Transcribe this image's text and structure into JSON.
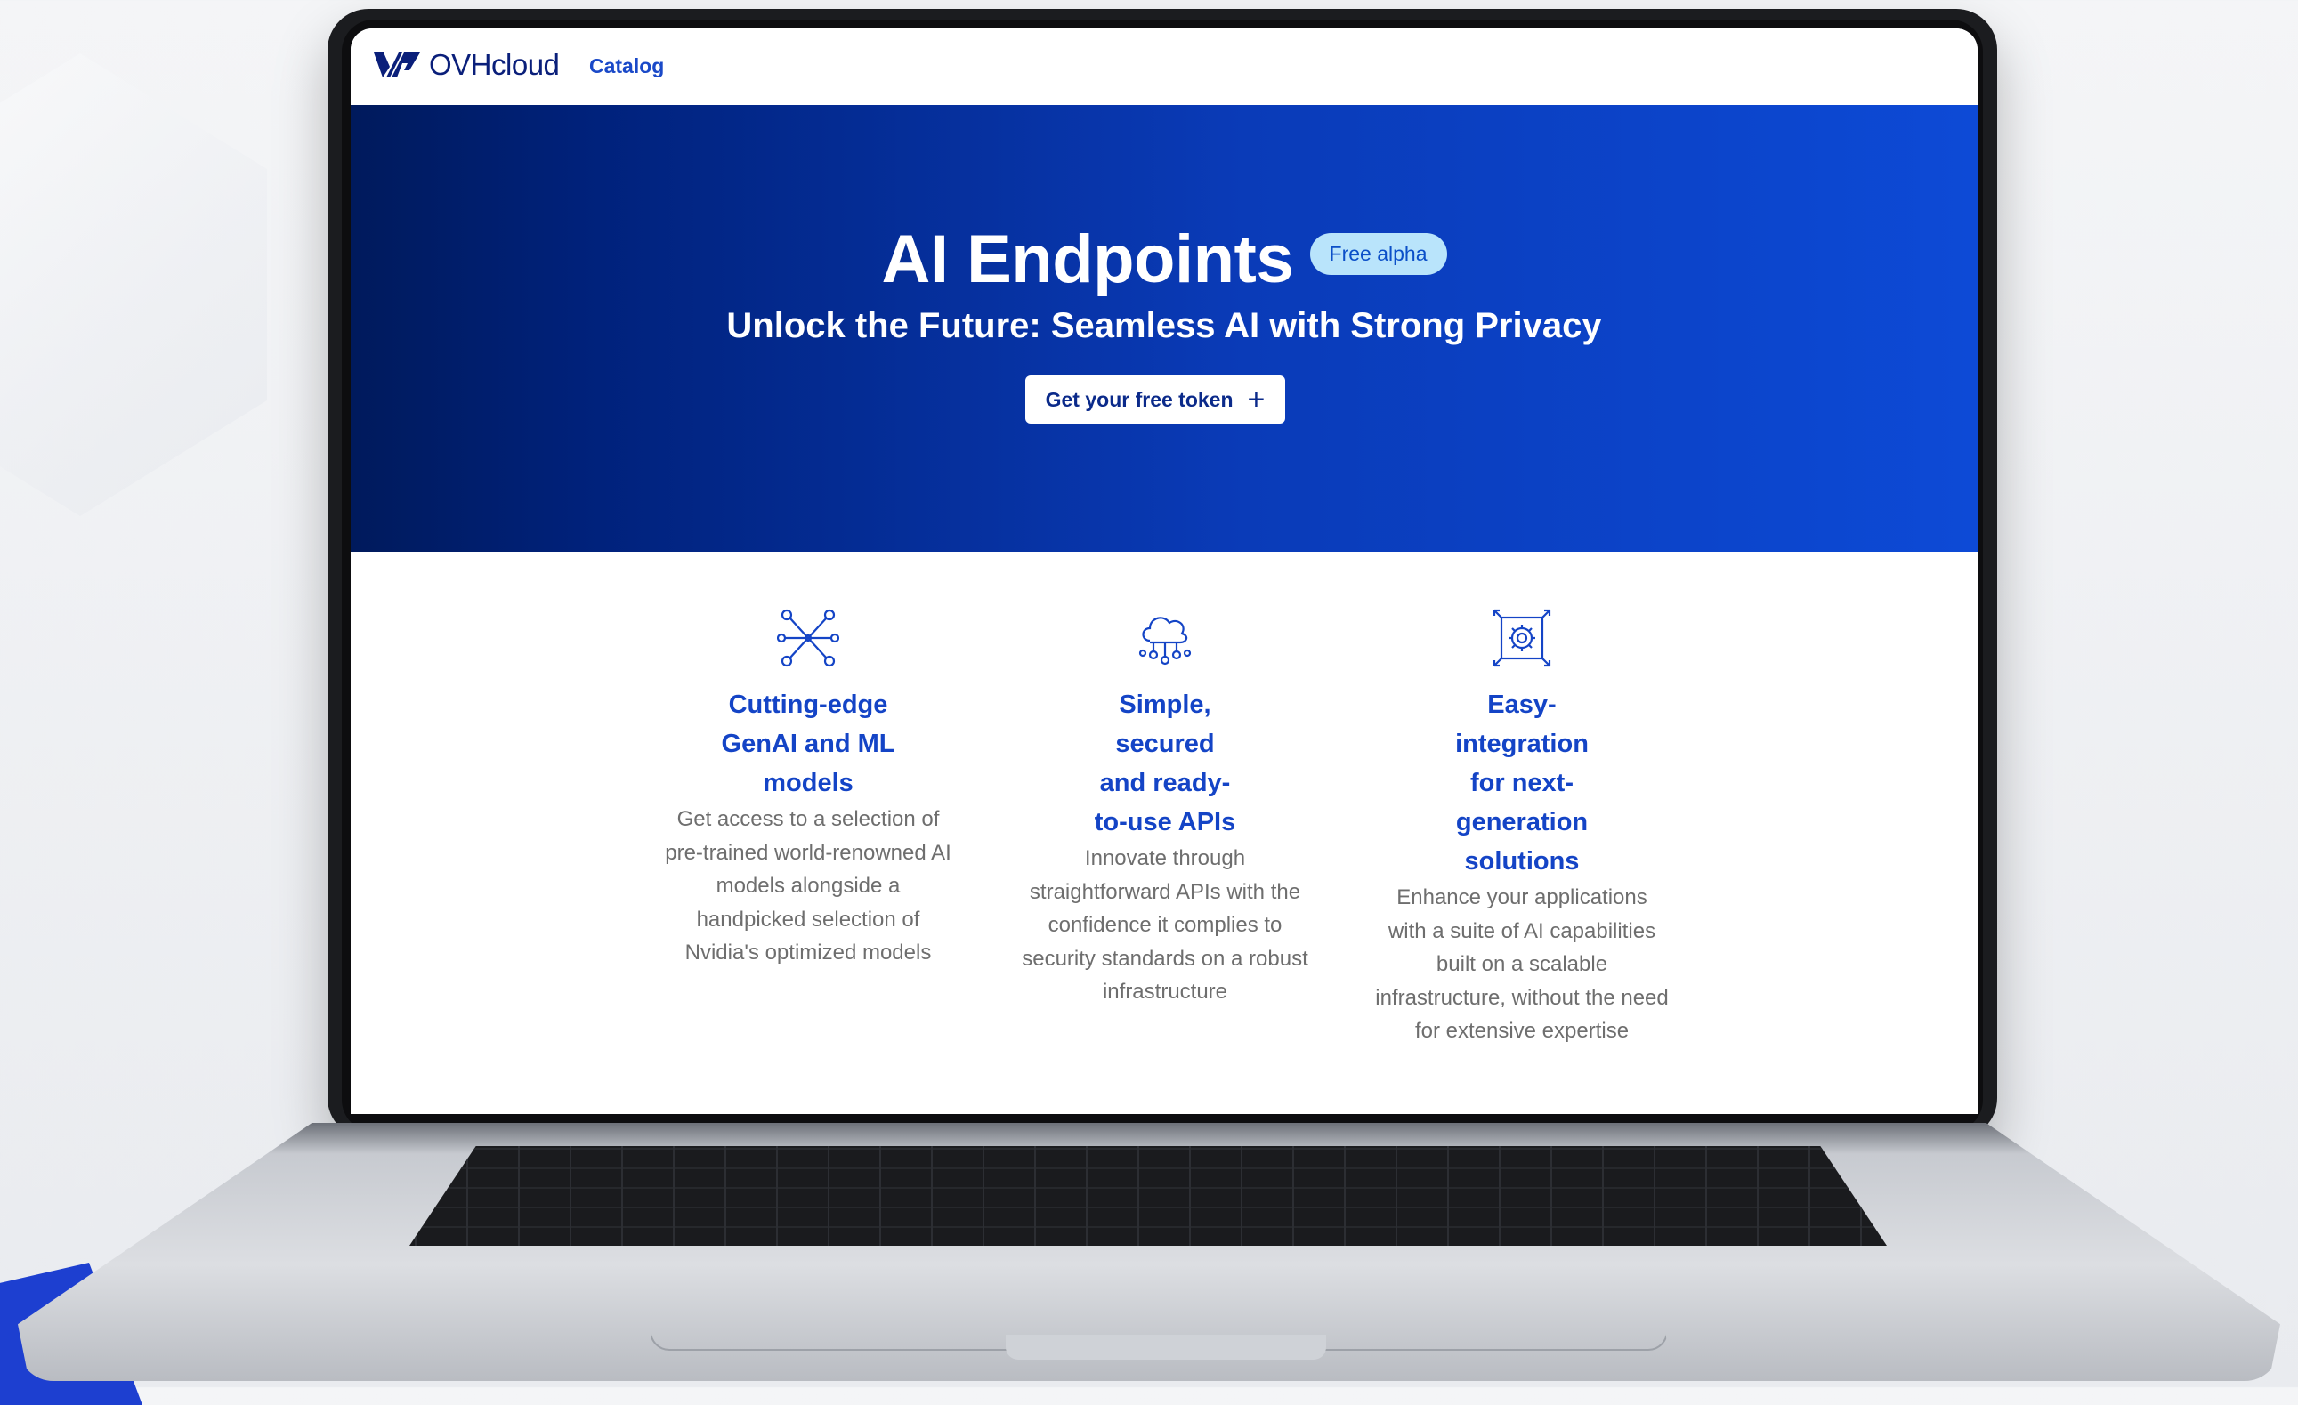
{
  "brand": {
    "name": "OVHcloud",
    "mark_color": "#0a1f7a"
  },
  "nav": {
    "catalog_label": "Catalog"
  },
  "hero": {
    "title": "AI Endpoints",
    "badge": "Free alpha",
    "subtitle": "Unlock the Future: Seamless AI with Strong Privacy",
    "cta_label": "Get your free token",
    "cta_icon": "plus-icon",
    "gradient_start": "#001a5c",
    "gradient_end": "#0d4ad6"
  },
  "features": [
    {
      "icon": "network-nodes-icon",
      "title": "Cutting-edge GenAI and ML models",
      "description": "Get access to a selection of pre-trained world-renowned AI models alongside a handpicked selection of Nvidia's optimized models"
    },
    {
      "icon": "cloud-network-icon",
      "title": "Simple, secured and ready-to-use APIs",
      "description": "Innovate through straightforward APIs with the confidence it complies to security standards on a robust infrastructure"
    },
    {
      "icon": "gear-scale-icon",
      "title": "Easy-integration for next-generation solutions",
      "description": "Enhance your applications with a suite of AI capabilities built on a scalable infrastructure, without the need for extensive expertise"
    }
  ],
  "colors": {
    "accent": "#1444c6",
    "badge_bg": "#b9e4fb",
    "body_text": "#6e6e6e"
  }
}
